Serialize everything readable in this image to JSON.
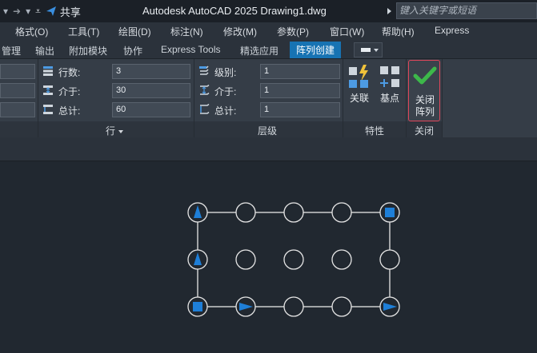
{
  "titlebar": {
    "share_label": "共享",
    "title": "Autodesk AutoCAD 2025    Drawing1.dwg",
    "search_placeholder": "键入关键字或短语"
  },
  "menubar": {
    "items": [
      "格式(O)",
      "工具(T)",
      "绘图(D)",
      "标注(N)",
      "修改(M)",
      "参数(P)",
      "窗口(W)",
      "帮助(H)",
      "Express"
    ]
  },
  "tabs": {
    "items": [
      "管理",
      "输出",
      "附加模块",
      "协作",
      "Express Tools",
      "精选应用",
      "阵列创建"
    ],
    "active": "阵列创建"
  },
  "ribbon": {
    "rows": {
      "row_count_label": "行数:",
      "row_count_value": "3",
      "spacing_label": "介于:",
      "spacing_value": "30",
      "total_label": "总计:",
      "total_value": "60",
      "panel_title": "行"
    },
    "levels": {
      "level_label": "级别:",
      "level_value": "1",
      "spacing_label": "介于:",
      "spacing_value": "1",
      "total_label": "总计:",
      "total_value": "1",
      "panel_title": "层级"
    },
    "properties": {
      "associative_label": "关联",
      "base_point_label": "基点",
      "panel_title": "特性"
    },
    "close": {
      "close_line1": "关闭",
      "close_line2": "阵列",
      "panel_title": "关闭"
    }
  },
  "drawing": {
    "array_rows": 3,
    "array_columns": 5,
    "grip_color": "#1e7fd8",
    "object_color": "#e6e6e6"
  },
  "colors": {
    "accent": "#1773b3",
    "close_border": "#e0465b",
    "check": "#3db84a"
  }
}
